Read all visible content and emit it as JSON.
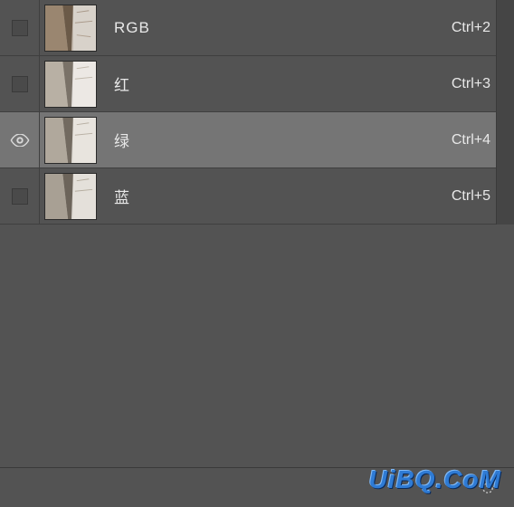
{
  "channels": [
    {
      "name": "RGB",
      "shortcut": "Ctrl+2",
      "visible": false,
      "selected": false,
      "color": true
    },
    {
      "name": "红",
      "shortcut": "Ctrl+3",
      "visible": false,
      "selected": false,
      "color": false
    },
    {
      "name": "绿",
      "shortcut": "Ctrl+4",
      "visible": true,
      "selected": true,
      "color": false
    },
    {
      "name": "蓝",
      "shortcut": "Ctrl+5",
      "visible": false,
      "selected": false,
      "color": false
    }
  ],
  "watermark": "UiBQ.CoM"
}
